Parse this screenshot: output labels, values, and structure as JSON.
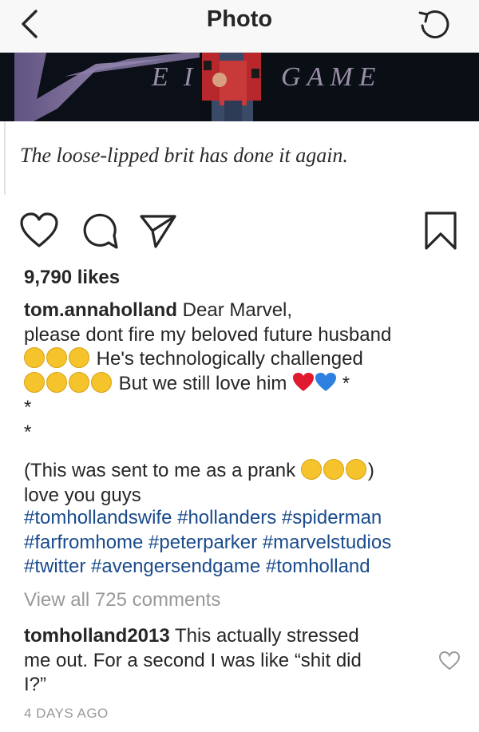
{
  "nav": {
    "title": "Photo",
    "back_icon": "chevron-left-icon",
    "right_icon": "refresh-icon"
  },
  "post_image": {
    "logo_text": "E GAME",
    "quote": "The loose-lipped brit has done it again."
  },
  "actions": {
    "icons": [
      "heart-icon",
      "comment-icon",
      "share-icon",
      "bookmark-icon"
    ]
  },
  "likes": "9,790 likes",
  "caption": {
    "username": "tom.annaholland",
    "line1_text": " Dear Marvel,",
    "line2": " please dont fire my beloved future husband",
    "line3_text": " He's technologically  challenged",
    "line4_text": " But we still love him",
    "star1": " *",
    "star2": "*",
    "star3": "*",
    "line5_text": "(This was sent to me as a prank",
    "line5_end": ")",
    "line6": "love you guys"
  },
  "hashtags": [
    "#tomhollandswife #hollanders #spiderman",
    "#farfromhome #peterparker #marvelstudios",
    "#twitter #avengersendgame #tomholland"
  ],
  "view_comments": "View all 725 comments",
  "comment": {
    "username": "tomholland2013",
    "text_line1": " This actually stressed",
    "text_line2": "me out. For a second I was like “shit did",
    "text_line3": "I?”"
  },
  "timestamp": "4 DAYS AGO",
  "colors": {
    "hashtag": "#1a4b8c",
    "muted": "#999999",
    "heart": "#e0192e",
    "blue_heart": "#2d7fe0",
    "emoji": "#f5c32c"
  }
}
